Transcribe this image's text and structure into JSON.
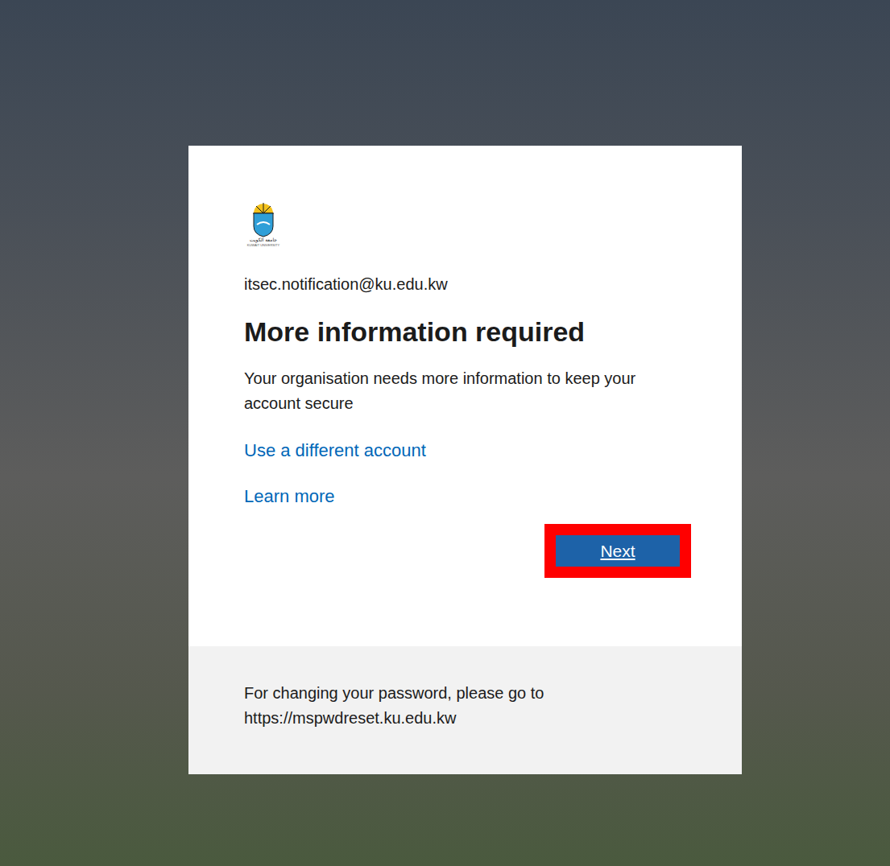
{
  "logo": {
    "arabic": "جامعة الكويت",
    "english": "KUWAIT UNIVERSITY"
  },
  "account": "itsec.notification@ku.edu.kw",
  "title": "More information required",
  "description": "Your organisation needs more information to keep your account secure",
  "links": [
    "Use a different account",
    "Learn more"
  ],
  "button": {
    "label": "Next",
    "highlighted": true
  },
  "footer": {
    "lines": [
      "For changing your password, please go to",
      "https://mspwdreset.ku.edu.kw"
    ]
  }
}
